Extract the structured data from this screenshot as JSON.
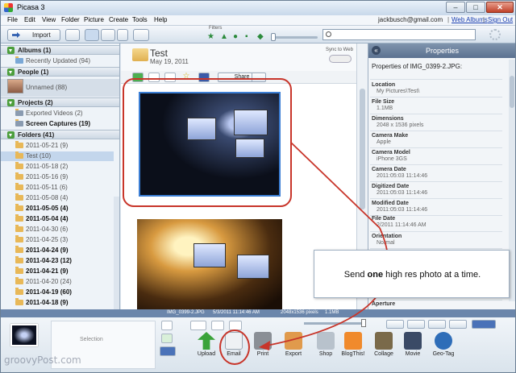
{
  "window": {
    "title": "Picasa 3",
    "controls": {
      "minimize": "–",
      "maximize": "□",
      "close": "✕"
    }
  },
  "menu": {
    "items": [
      "File",
      "Edit",
      "View",
      "Folder",
      "Picture",
      "Create",
      "Tools",
      "Help"
    ],
    "user_email": "jackbusch@gmail.com",
    "web_albums": "Web Albums",
    "sign_out": "Sign Out",
    "separator": "|"
  },
  "toolbar": {
    "import_label": "Import",
    "filters_label": "Filters"
  },
  "left_panel": {
    "albums": {
      "label": "Albums (1)",
      "items": [
        {
          "label": "Recently Updated (94)"
        }
      ]
    },
    "people": {
      "label": "People (1)",
      "items": [
        {
          "label": "Unnamed (88)"
        }
      ]
    },
    "projects": {
      "label": "Projects (2)",
      "items": [
        {
          "label": "Exported Videos (2)"
        },
        {
          "label": "Screen Captures (19)"
        }
      ]
    },
    "folders": {
      "label": "Folders (41)",
      "items": [
        {
          "label": "2011-05-21 (9)"
        },
        {
          "label": "Test (10)"
        },
        {
          "label": "2011-05-18 (2)"
        },
        {
          "label": "2011-05-16 (9)"
        },
        {
          "label": "2011-05-11 (6)"
        },
        {
          "label": "2011-05-08 (4)"
        },
        {
          "label": "2011-05-05 (4)"
        },
        {
          "label": "2011-05-04 (4)"
        },
        {
          "label": "2011-04-30 (6)"
        },
        {
          "label": "2011-04-25 (3)"
        },
        {
          "label": "2011-04-24 (9)"
        },
        {
          "label": "2011-04-23 (12)"
        },
        {
          "label": "2011-04-21 (9)"
        },
        {
          "label": "2011-04-20 (24)"
        },
        {
          "label": "2011-04-19 (60)"
        },
        {
          "label": "2011-04-18 (9)"
        }
      ]
    }
  },
  "album": {
    "title": "Test",
    "date": "May 19, 2011",
    "sync_label": "Sync to Web",
    "share_label": "Share"
  },
  "properties": {
    "title": "Properties",
    "of_label": "Properties of IMG_0399-2.JPG:",
    "rows": [
      {
        "key": "Location",
        "value": "My Pictures\\Test\\"
      },
      {
        "key": "File Size",
        "value": "1.1MB"
      },
      {
        "key": "Dimensions",
        "value": "2048 x 1536 pixels"
      },
      {
        "key": "Camera Make",
        "value": "Apple"
      },
      {
        "key": "Camera Model",
        "value": "iPhone 3GS"
      },
      {
        "key": "Camera Date",
        "value": "2011:05:03 11:14:46"
      },
      {
        "key": "Digitized Date",
        "value": "2011:05:03 11:14:46"
      },
      {
        "key": "Modified Date",
        "value": "2011:05:03 11:14:46"
      },
      {
        "key": "File Date",
        "value": "2/2011 11:14:46 AM"
      },
      {
        "key": "Orientation",
        "value": "Normal"
      },
      {
        "key": "Flash",
        "value": ""
      },
      {
        "key": "Aperture",
        "value": ""
      }
    ]
  },
  "status": {
    "filename": "IMG_0399-2.JPG",
    "datetime": "5/3/2011 11:14:46 AM",
    "dimensions": "2048x1536 pixels",
    "size": "1.1MB"
  },
  "bottom": {
    "selection_label": "Selection",
    "buttons": [
      {
        "label": "Upload",
        "color": "#3aa33a"
      },
      {
        "label": "Email",
        "color": "#d8dde3"
      },
      {
        "label": "Print",
        "color": "#8a8f96"
      },
      {
        "label": "Export",
        "color": "#e09a4c"
      },
      {
        "label": "Shop",
        "color": "#b8c2cc"
      },
      {
        "label": "BlogThis!",
        "color": "#f08a2c"
      },
      {
        "label": "Collage",
        "color": "#7a6a4a"
      },
      {
        "label": "Movie",
        "color": "#3a4a66"
      },
      {
        "label": "Geo-Tag",
        "color": "#2e6db8"
      }
    ]
  },
  "callout": {
    "before": "Send ",
    "bold": "one",
    "after": " high res photo at a time."
  },
  "watermark": "groovyPost.com",
  "colors": {
    "accent": "#3b7ed4",
    "annotation": "#c8352a"
  }
}
